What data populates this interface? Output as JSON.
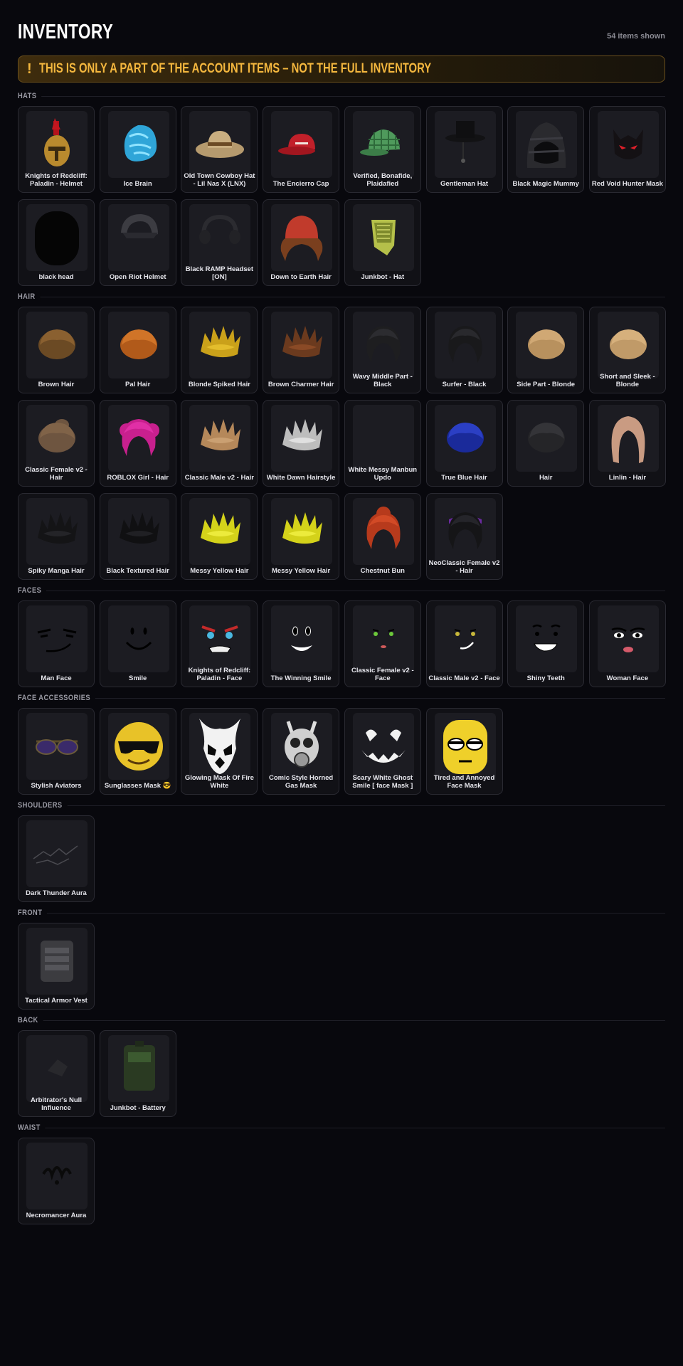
{
  "header": {
    "title": "INVENTORY",
    "count": "54 items shown"
  },
  "banner": {
    "icon": "!",
    "text": "THIS IS ONLY A PART OF THE ACCOUNT ITEMS – NOT THE FULL INVENTORY"
  },
  "sections": [
    {
      "label": "HATS",
      "items": [
        {
          "name": "Knights of Redcliff: Paladin - Helmet",
          "icon": "knight-helmet-icon"
        },
        {
          "name": "Ice Brain",
          "icon": "ice-brain-icon"
        },
        {
          "name": "Old Town Cowboy Hat - Lil Nas X (LNX)",
          "icon": "cowboy-hat-icon"
        },
        {
          "name": "The Encierro Cap",
          "icon": "red-cap-icon"
        },
        {
          "name": "Verified, Bonafide, Plaidafied",
          "icon": "plaid-cap-icon"
        },
        {
          "name": "Gentleman Hat",
          "icon": "top-hat-icon"
        },
        {
          "name": "Black Magic Mummy",
          "icon": "mummy-hood-icon"
        },
        {
          "name": "Red Void Hunter Mask",
          "icon": "void-mask-icon"
        },
        {
          "name": "black head",
          "icon": "black-head-icon"
        },
        {
          "name": "Open Riot Helmet",
          "icon": "riot-helmet-icon"
        },
        {
          "name": "Black RAMP Headset [ON]",
          "icon": "headset-icon"
        },
        {
          "name": "Down to Earth Hair",
          "icon": "beanie-hair-icon"
        },
        {
          "name": "Junkbot - Hat",
          "icon": "junkbot-hat-icon"
        }
      ]
    },
    {
      "label": "HAIR",
      "items": [
        {
          "name": "Brown Hair",
          "icon": "brown-hair-icon"
        },
        {
          "name": "Pal Hair",
          "icon": "pal-hair-icon"
        },
        {
          "name": "Blonde Spiked Hair",
          "icon": "blonde-spiked-hair-icon"
        },
        {
          "name": "Brown Charmer Hair",
          "icon": "brown-charmer-hair-icon"
        },
        {
          "name": "Wavy Middle Part - Black",
          "icon": "wavy-black-hair-icon"
        },
        {
          "name": "Surfer - Black",
          "icon": "surfer-black-hair-icon"
        },
        {
          "name": "Side Part - Blonde",
          "icon": "side-part-blonde-hair-icon"
        },
        {
          "name": "Short and Sleek - Blonde",
          "icon": "short-sleek-blonde-hair-icon"
        },
        {
          "name": "Classic Female v2 - Hair",
          "icon": "classic-female-hair-icon"
        },
        {
          "name": "ROBLOX Girl - Hair",
          "icon": "pink-pigtails-hair-icon"
        },
        {
          "name": "Classic Male v2 - Hair",
          "icon": "classic-male-hair-icon"
        },
        {
          "name": "White Dawn Hairstyle",
          "icon": "white-dawn-hair-icon"
        },
        {
          "name": "White Messy Manbun Updo",
          "icon": "white-manbun-hair-icon"
        },
        {
          "name": "True Blue Hair",
          "icon": "blue-hair-icon"
        },
        {
          "name": "Hair",
          "icon": "dark-hair-icon"
        },
        {
          "name": "Linlin - Hair",
          "icon": "linlin-hair-icon"
        },
        {
          "name": "Spiky Manga Hair",
          "icon": "spiky-manga-hair-icon"
        },
        {
          "name": "Black Textured Hair",
          "icon": "black-textured-hair-icon"
        },
        {
          "name": "Messy Yellow Hair",
          "icon": "messy-yellow-hair-icon"
        },
        {
          "name": "Messy Yellow Hair",
          "icon": "messy-yellow-hair-icon"
        },
        {
          "name": "Chestnut Bun",
          "icon": "chestnut-bun-hair-icon"
        },
        {
          "name": "NeoClassic Female v2 - Hair",
          "icon": "neoclassic-hair-icon"
        }
      ]
    },
    {
      "label": "FACES",
      "items": [
        {
          "name": "Man Face",
          "icon": "man-face-icon"
        },
        {
          "name": "Smile",
          "icon": "smile-face-icon"
        },
        {
          "name": "Knights of Redcliff: Paladin - Face",
          "icon": "paladin-face-icon"
        },
        {
          "name": "The Winning Smile",
          "icon": "winning-smile-face-icon"
        },
        {
          "name": "Classic Female v2 - Face",
          "icon": "classic-female-face-icon"
        },
        {
          "name": "Classic Male v2 - Face",
          "icon": "classic-male-face-icon"
        },
        {
          "name": "Shiny Teeth",
          "icon": "shiny-teeth-face-icon"
        },
        {
          "name": "Woman Face",
          "icon": "woman-face-icon"
        }
      ]
    },
    {
      "label": "FACE ACCESSORIES",
      "items": [
        {
          "name": "Stylish Aviators",
          "icon": "aviators-icon"
        },
        {
          "name": "Sunglasses Mask 😎",
          "icon": "sunglasses-emoji-icon"
        },
        {
          "name": "Glowing Mask Of Fire White",
          "icon": "fire-mask-icon"
        },
        {
          "name": "Comic Style Horned Gas Mask",
          "icon": "gas-mask-icon"
        },
        {
          "name": "Scary White Ghost Smile [ face Mask ]",
          "icon": "ghost-smile-icon"
        },
        {
          "name": "Tired and Annoyed Face Mask",
          "icon": "tired-face-icon"
        }
      ]
    },
    {
      "label": "SHOULDERS",
      "items": [
        {
          "name": "Dark Thunder Aura",
          "icon": "thunder-aura-icon"
        }
      ]
    },
    {
      "label": "FRONT",
      "items": [
        {
          "name": "Tactical Armor Vest",
          "icon": "armor-vest-icon"
        }
      ]
    },
    {
      "label": "BACK",
      "items": [
        {
          "name": "Arbitrator's Null Influence",
          "icon": "null-influence-icon"
        },
        {
          "name": "Junkbot - Battery",
          "icon": "battery-icon"
        }
      ]
    },
    {
      "label": "WAIST",
      "items": [
        {
          "name": "Necromancer Aura",
          "icon": "necromancer-aura-icon"
        }
      ]
    }
  ]
}
